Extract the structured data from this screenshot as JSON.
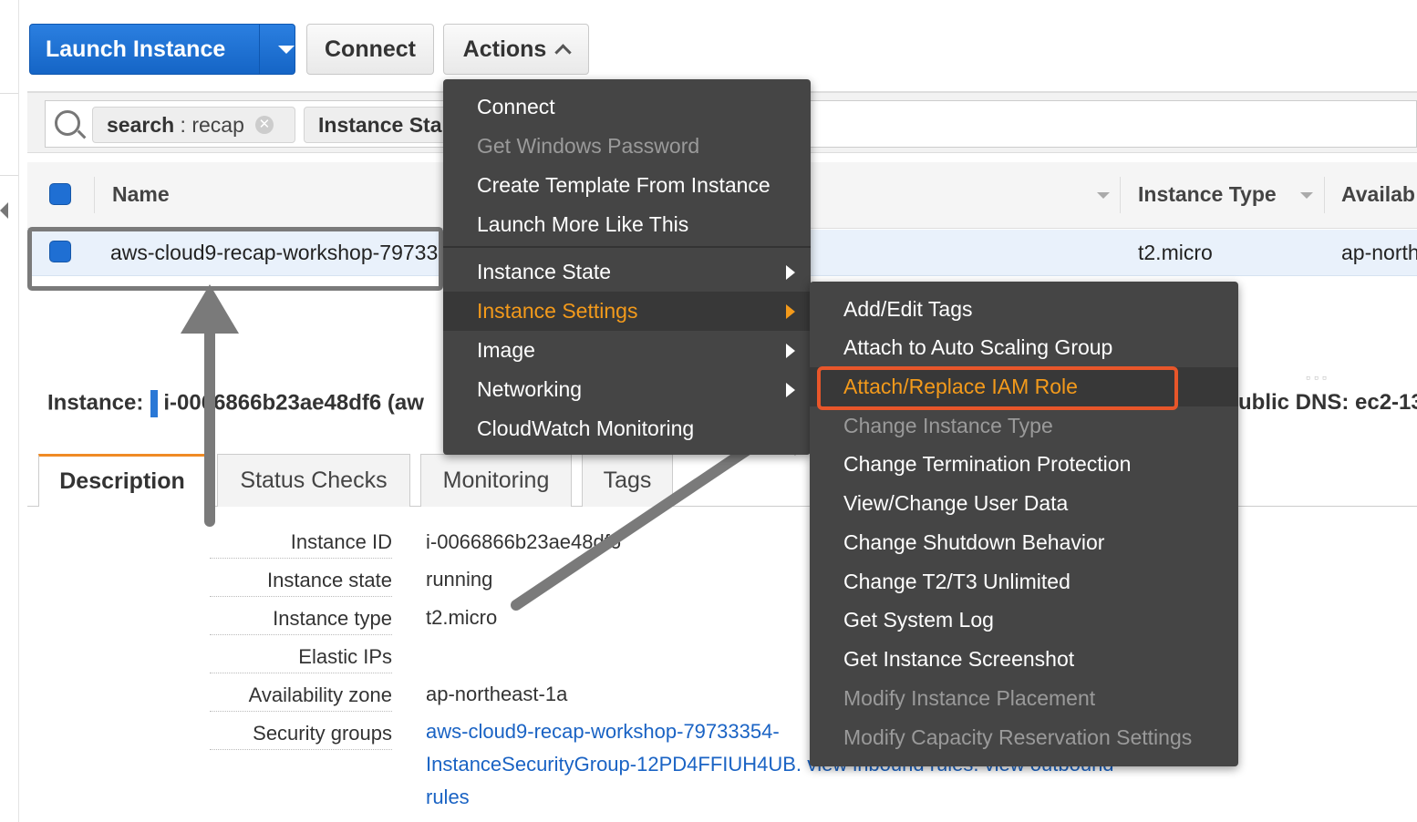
{
  "toolbar": {
    "launch_label": "Launch Instance",
    "connect_label": "Connect",
    "actions_label": "Actions"
  },
  "filter": {
    "chip1_key": "search",
    "chip1_sep": " : ",
    "chip1_value": "recap",
    "chip2_label": "Instance Sta"
  },
  "table": {
    "headers": {
      "name": "Name",
      "instance_type": "Instance Type",
      "availability": "Availab"
    },
    "row": {
      "name": "aws-cloud9-recap-workshop-79733",
      "instance_type": "t2.micro",
      "availability": "ap-north"
    }
  },
  "detail_header": {
    "prefix": "Instance:",
    "id_text": "i-0066866b23ae48df6 (aw",
    "public_dns": "ublic DNS: ec2-13",
    "drag_dots": "▫▫▫"
  },
  "tabs": [
    "Description",
    "Status Checks",
    "Monitoring",
    "Tags"
  ],
  "details": {
    "instance_id_label": "Instance ID",
    "instance_id_value": "i-0066866b23ae48df6",
    "instance_state_label": "Instance state",
    "instance_state_value": "running",
    "instance_type_label": "Instance type",
    "instance_type_value": "t2.micro",
    "elastic_ips_label": "Elastic IPs",
    "elastic_ips_value": "",
    "az_label": "Availability zone",
    "az_value": "ap-northeast-1a",
    "sg_label": "Security groups",
    "sg_link_line1": "aws-cloud9-recap-workshop-79733354-",
    "sg_link_line2": "InstanceSecurityGroup-12PD4FFIUH4UB.",
    "sg_view_inbound": "view inbound rules.",
    "sg_view_outbound": "view outbound",
    "sg_rules": "rules"
  },
  "actions_menu": {
    "items": [
      {
        "label": "Connect",
        "disabled": false
      },
      {
        "label": "Get Windows Password",
        "disabled": true
      },
      {
        "label": "Create Template From Instance",
        "disabled": false
      },
      {
        "label": "Launch More Like This",
        "disabled": false
      },
      {
        "label": "Instance State",
        "disabled": false
      },
      {
        "label": "Instance Settings",
        "disabled": false,
        "active": true
      },
      {
        "label": "Image",
        "disabled": false
      },
      {
        "label": "Networking",
        "disabled": false
      },
      {
        "label": "CloudWatch Monitoring",
        "disabled": false
      }
    ]
  },
  "settings_submenu": {
    "items": [
      {
        "label": "Add/Edit Tags",
        "disabled": false
      },
      {
        "label": "Attach to Auto Scaling Group",
        "disabled": false
      },
      {
        "label": "Attach/Replace IAM Role",
        "disabled": false,
        "active": true
      },
      {
        "label": "Change Instance Type",
        "disabled": true
      },
      {
        "label": "Change Termination Protection",
        "disabled": false
      },
      {
        "label": "View/Change User Data",
        "disabled": false
      },
      {
        "label": "Change Shutdown Behavior",
        "disabled": false
      },
      {
        "label": "Change T2/T3 Unlimited",
        "disabled": false
      },
      {
        "label": "Get System Log",
        "disabled": false
      },
      {
        "label": "Get Instance Screenshot",
        "disabled": false
      },
      {
        "label": "Modify Instance Placement",
        "disabled": true
      },
      {
        "label": "Modify Capacity Reservation Settings",
        "disabled": true
      }
    ]
  },
  "colors": {
    "primary_button": "#1f6fd3",
    "menu_bg": "#454545",
    "menu_highlight_text": "#f39a1b",
    "callout_box": "#e8562a",
    "link": "#1a63c4",
    "annotation_arrow": "#7a7a7a"
  }
}
